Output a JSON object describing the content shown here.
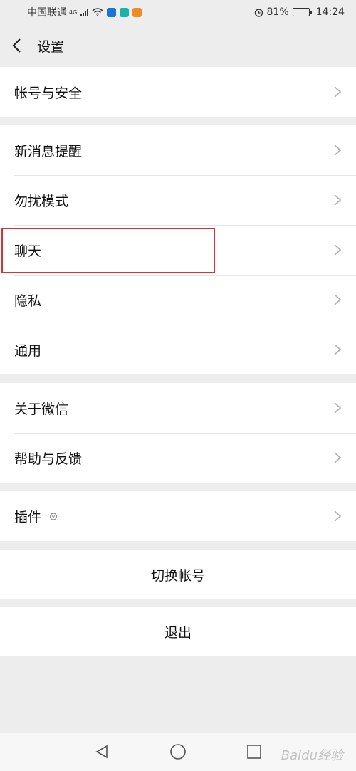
{
  "status": {
    "carrier": "中国联通",
    "network": "4G",
    "battery": "81%",
    "battery_fraction": 0.81,
    "time": "14:24"
  },
  "nav": {
    "title": "设置"
  },
  "groups": [
    {
      "items": [
        {
          "label": "帐号与安全"
        }
      ]
    },
    {
      "items": [
        {
          "label": "新消息提醒"
        },
        {
          "label": "勿扰模式"
        },
        {
          "label": "聊天"
        },
        {
          "label": "隐私"
        },
        {
          "label": "通用"
        }
      ]
    },
    {
      "items": [
        {
          "label": "关于微信"
        },
        {
          "label": "帮助与反馈"
        }
      ]
    },
    {
      "items": [
        {
          "label": "插件"
        }
      ]
    }
  ],
  "actions": {
    "switch_account": "切换帐号",
    "logout": "退出"
  },
  "watermark": "Baidu经验",
  "colors": {
    "highlight": "#d6323a",
    "background": "#ededed"
  }
}
